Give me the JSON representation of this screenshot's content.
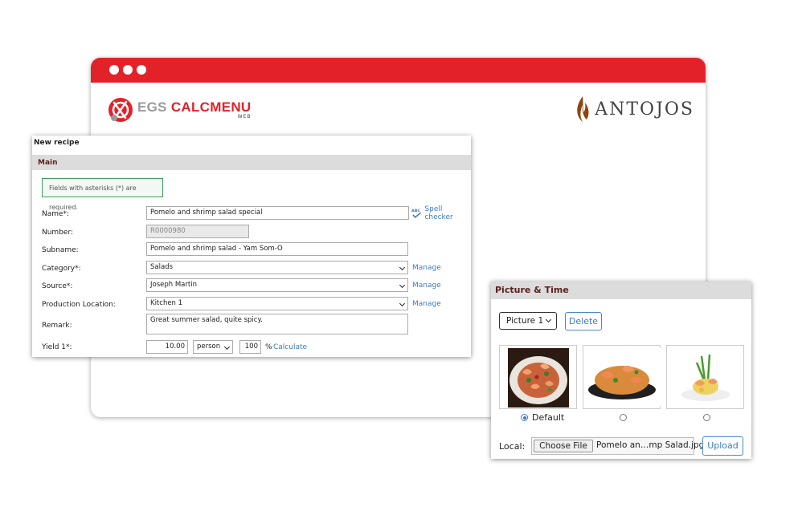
{
  "brand": {
    "logo_primary": "EGS",
    "logo_secondary": "CALCMENU",
    "logo_sub": "WEB",
    "client_name": "ANTOJOS"
  },
  "colors": {
    "accent": "#e32129",
    "link": "#3a7bbf",
    "section_title": "#5a1f1f",
    "alert_border": "#3f9f5f"
  },
  "recipe": {
    "title": "New recipe",
    "section": "Main",
    "alert": "Fields with asterisks (*) are required.",
    "spell_checker": "Spell checker",
    "manage_label": "Manage",
    "fields": {
      "name": {
        "label": "Name*:",
        "value": "Pomelo and shrimp salad special"
      },
      "number": {
        "label": "Number:",
        "value": "R0000980"
      },
      "subname": {
        "label": "Subname:",
        "value": "Pomelo and shrimp salad - Yam Som-O"
      },
      "category": {
        "label": "Category*:",
        "value": "Salads"
      },
      "source": {
        "label": "Source*:",
        "value": "Joseph Martin"
      },
      "production_location": {
        "label": "Production Location:",
        "value": "Kitchen 1"
      },
      "remark": {
        "label": "Remark:",
        "value": "Great summer salad, quite spicy."
      },
      "yield": {
        "label": "Yield 1*:",
        "quantity": "10.00",
        "unit": "person",
        "percent": "100",
        "percent_sign": "%",
        "calculate": "Calculate"
      }
    }
  },
  "picture": {
    "title": "Picture & Time",
    "selected_picture": "Picture 1",
    "delete_label": "Delete",
    "default_label": "Default",
    "local_label": "Local:",
    "choose_file_label": "Choose File",
    "file_name": "Pomelo an…mp Salad.jpg",
    "upload_label": "Upload",
    "thumbnails": [
      "shrimp-pasta-plate",
      "shrimp-noodle-bowl",
      "shrimp-salad-plate"
    ],
    "default_index": 0
  }
}
